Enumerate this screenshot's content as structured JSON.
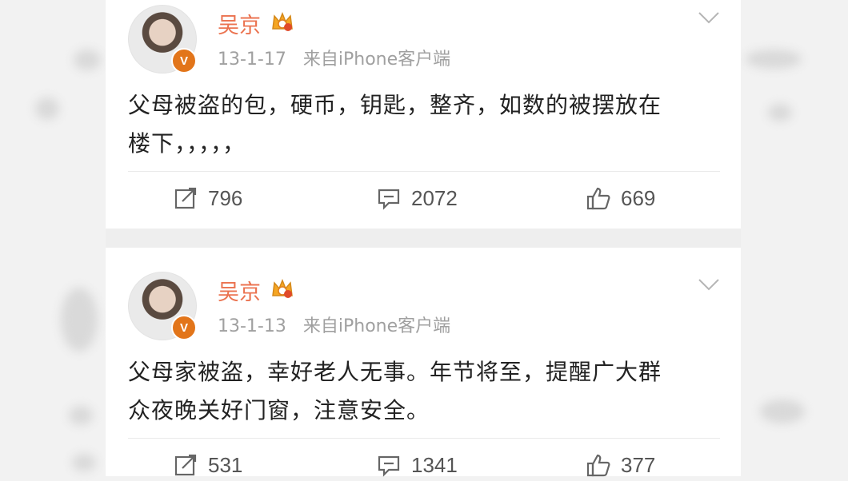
{
  "posts": [
    {
      "author": "吴京",
      "date": "13-1-17",
      "source": "来自iPhone客户端",
      "text_line1": "父母被盗的包，硬币，钥匙，整齐，如数的被摆放在",
      "text_line2": "楼下，，，，，",
      "reposts": "796",
      "comments": "2072",
      "likes": "669"
    },
    {
      "author": "吴京",
      "date": "13-1-13",
      "source": "来自iPhone客户端",
      "text_line1": "父母家被盗，幸好老人无事。年节将至，提醒广大群",
      "text_line2": "众夜晚关好门窗，注意安全。",
      "reposts": "531",
      "comments": "1341",
      "likes": "377"
    }
  ],
  "verified_badge": "V",
  "colors": {
    "name": "#eb7350",
    "meta": "#a0a0a0",
    "badge": "#e2751a",
    "text": "#222222"
  }
}
